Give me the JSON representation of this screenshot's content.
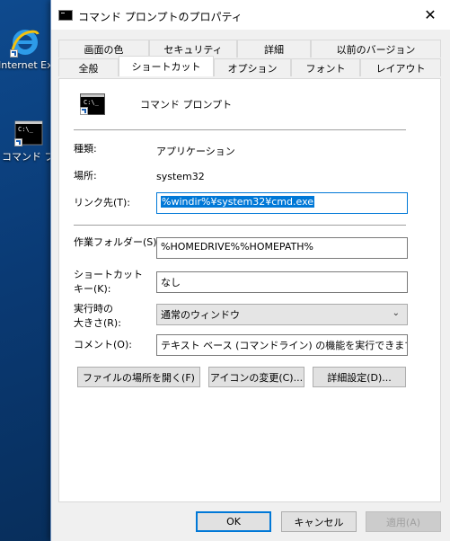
{
  "desktop": {
    "icons": [
      {
        "label": "Internet Ex"
      },
      {
        "label": "コマンド プロ"
      }
    ]
  },
  "window": {
    "title": "コマンド プロンプトのプロパティ",
    "close_glyph": "✕"
  },
  "tabs": {
    "row1": [
      "画面の色",
      "セキュリティ",
      "詳細",
      "以前のバージョン"
    ],
    "row2": [
      "全般",
      "ショートカット",
      "オプション",
      "フォント",
      "レイアウト"
    ],
    "active": "ショートカット"
  },
  "shortcut": {
    "name": "コマンド プロンプト",
    "type_label": "種類:",
    "type_value": "アプリケーション",
    "location_label": "場所:",
    "location_value": "system32",
    "target_label": "リンク先(T):",
    "target_value": "%windir%¥system32¥cmd.exe",
    "startin_label": "作業フォルダー(S):",
    "startin_value": "%HOMEDRIVE%%HOMEPATH%",
    "hotkey_label_1": "ショートカット",
    "hotkey_label_2": "キー(K):",
    "hotkey_value": "なし",
    "run_label_1": "実行時の",
    "run_label_2": "大きさ(R):",
    "run_value": "通常のウィンドウ",
    "comment_label": "コメント(O):",
    "comment_value": "テキスト ベース (コマンドライン) の機能を実行できます。",
    "open_location_button": "ファイルの場所を開く(F)",
    "change_icon_button": "アイコンの変更(C)...",
    "advanced_button": "詳細設定(D)..."
  },
  "footer": {
    "ok": "OK",
    "cancel": "キャンセル",
    "apply": "適用(A)"
  },
  "colors": {
    "accent": "#0078d7",
    "panel_bg": "#f0f0f0"
  }
}
